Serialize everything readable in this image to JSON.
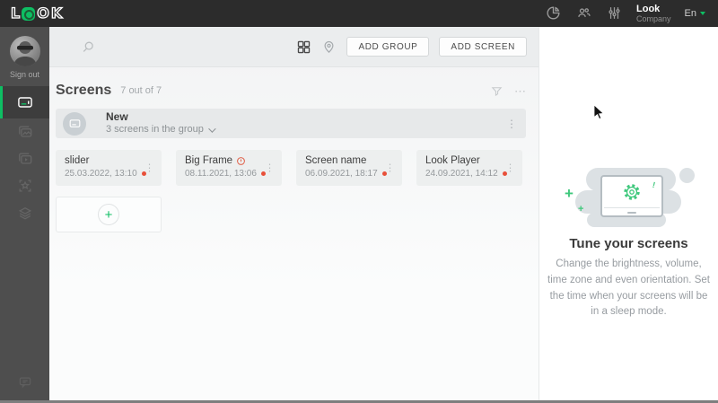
{
  "logo": {
    "letters": [
      "L",
      "O",
      "O",
      "K"
    ]
  },
  "topbar": {
    "company_name": "Look",
    "company_type": "Company",
    "language": "En"
  },
  "sidebar": {
    "sign_out": "Sign out"
  },
  "toolbar": {
    "add_group": "ADD GROUP",
    "add_screen": "ADD SCREEN"
  },
  "header": {
    "title": "Screens",
    "count": "7 out of 7"
  },
  "group": {
    "name": "New",
    "subtitle": "3 screens in the group"
  },
  "screens": [
    {
      "name": "slider",
      "date": "25.03.2022, 13:10"
    },
    {
      "name": "Big Frame",
      "date": "08.11.2021, 13:06",
      "warning": true
    },
    {
      "name": "Screen name",
      "date": "06.09.2021, 18:17"
    },
    {
      "name": "Look Player",
      "date": "24.09.2021, 14:12"
    }
  ],
  "panel": {
    "title": "Tune your screens",
    "description": "Change the brightness, volume, time zone and even orientation. Set the time when your screens will be in a sleep mode."
  },
  "icons": {
    "v_ellipsis": "⋮",
    "h_ellipsis": "⋯",
    "plus": "+"
  },
  "colors": {
    "accent": "#0ebe63",
    "illustration_green": "#3fc87c",
    "status_dot": "#e8503a",
    "warning": "#e0614a",
    "topbar_bg": "#2c2c2c",
    "sidebar_bg": "#4e4e4e"
  }
}
